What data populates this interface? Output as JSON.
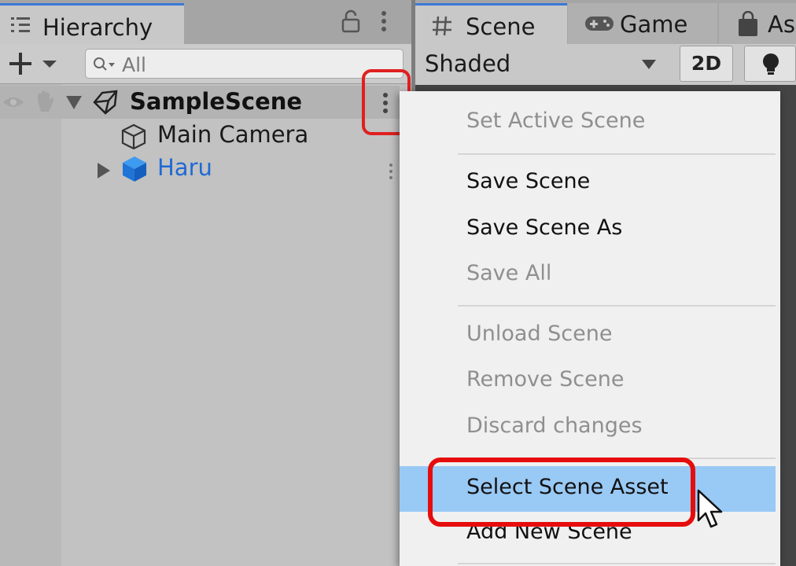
{
  "hierarchy": {
    "tab_label": "Hierarchy",
    "search_placeholder": "All",
    "scene_name": "SampleScene",
    "items": [
      {
        "label": "Main Camera",
        "icon": "camera-cube-icon"
      },
      {
        "label": "Haru",
        "icon": "blue-cube-icon",
        "color": "#1f6ad4"
      }
    ]
  },
  "scene_panel": {
    "tabs": [
      {
        "label": "Scene",
        "icon": "hash-icon",
        "active": true
      },
      {
        "label": "Game",
        "icon": "gamepad-icon",
        "active": false
      },
      {
        "label": "As",
        "icon": "bag-icon",
        "active": false
      }
    ],
    "shading_mode": "Shaded",
    "toggle_2d": "2D"
  },
  "context_menu": {
    "items": [
      {
        "label": "Set Active Scene",
        "enabled": false
      },
      {
        "label": "Save Scene",
        "enabled": true
      },
      {
        "label": "Save Scene As",
        "enabled": true
      },
      {
        "label": "Save All",
        "enabled": false
      },
      {
        "label": "Unload Scene",
        "enabled": false
      },
      {
        "label": "Remove Scene",
        "enabled": false
      },
      {
        "label": "Discard changes",
        "enabled": false
      },
      {
        "label": "Select Scene Asset",
        "enabled": true,
        "highlighted": true
      },
      {
        "label": "Add New Scene",
        "enabled": true
      }
    ]
  },
  "colors": {
    "accent_tab": "#3a79d8",
    "highlight_box": "#e60d0d",
    "menu_hover": "#99c9f5",
    "prefab_text": "#1f6ad4"
  }
}
